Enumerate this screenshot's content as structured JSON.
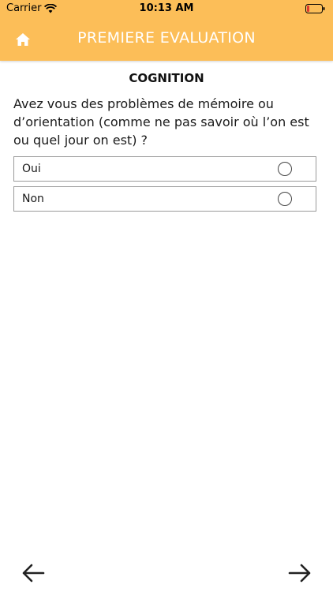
{
  "status_bar": {
    "carrier": "Carrier",
    "time": "10:13 AM"
  },
  "nav": {
    "title": "PREMIERE EVALUATION",
    "home_icon": "home-icon"
  },
  "section": {
    "title": "COGNITION"
  },
  "question": {
    "text": "Avez vous des problèmes de mémoire ou d’orientation (comme ne pas savoir où l’on est ou quel jour on est) ?"
  },
  "options": [
    {
      "label": "Oui",
      "selected": false
    },
    {
      "label": "Non",
      "selected": false
    }
  ],
  "footer": {
    "back_icon": "arrow-left-icon",
    "next_icon": "arrow-right-icon"
  },
  "colors": {
    "header_bg": "#FCBE58",
    "header_text": "#ffffff"
  }
}
